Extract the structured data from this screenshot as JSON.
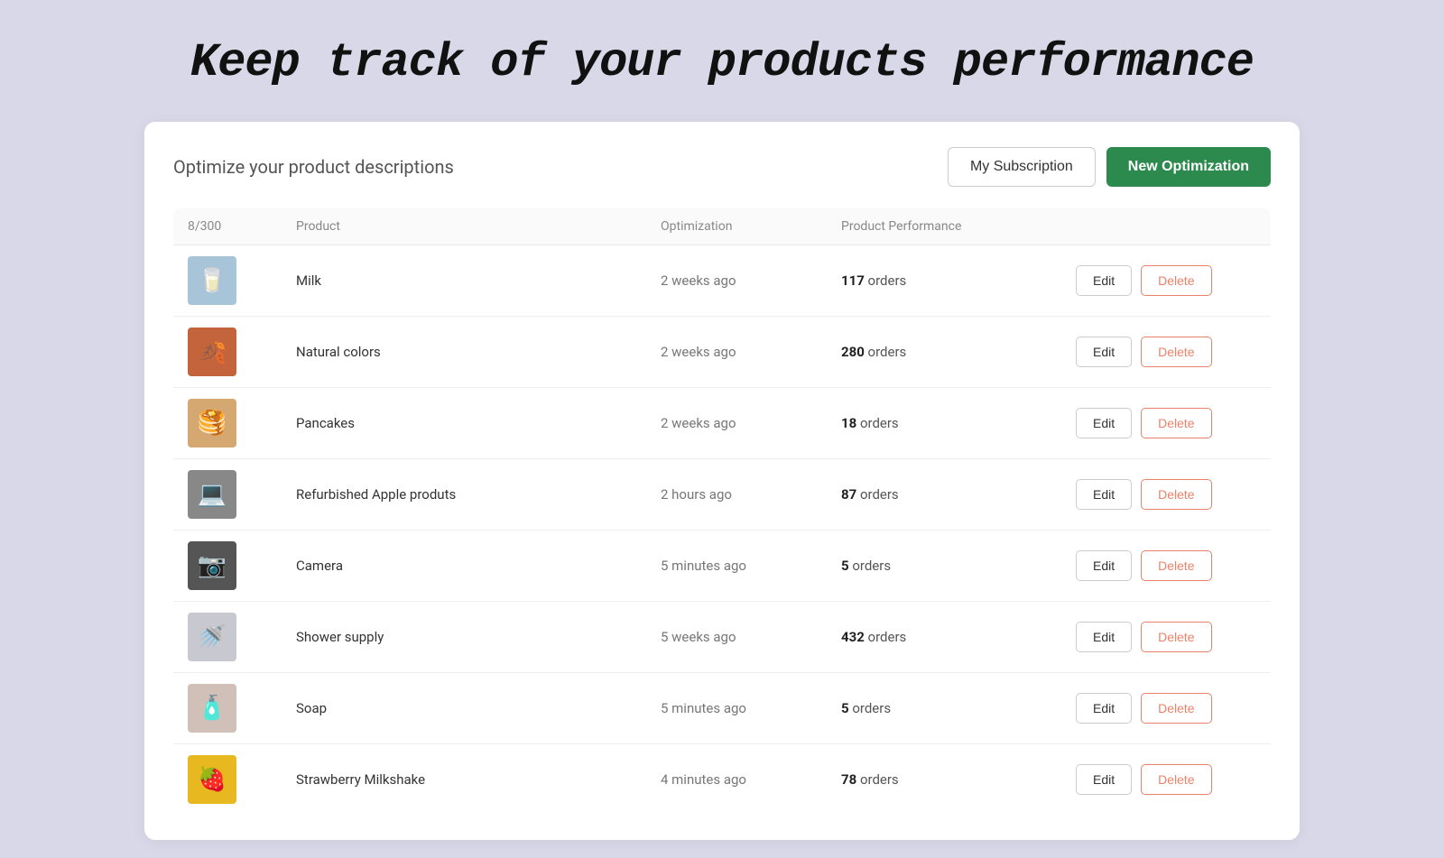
{
  "page": {
    "heading": "Keep track of your products performance",
    "card": {
      "title": "Optimize your product descriptions",
      "buttons": {
        "subscription": "My Subscription",
        "new_optimization": "New Optimization"
      },
      "table": {
        "counter": "8/300",
        "columns": [
          "",
          "Product",
          "Optimization",
          "Product Performance",
          "",
          ""
        ],
        "col_labels": {
          "counter": "8/300",
          "product": "Product",
          "optimization": "Optimization",
          "performance": "Product Performance"
        },
        "rows": [
          {
            "id": 1,
            "product": "Milk",
            "optimization": "2 weeks ago",
            "orders_count": "117",
            "orders_label": "orders",
            "thumb_emoji": "🥛",
            "thumb_class": "thumb-milk"
          },
          {
            "id": 2,
            "product": "Natural colors",
            "optimization": "2 weeks ago",
            "orders_count": "280",
            "orders_label": "orders",
            "thumb_emoji": "🍂",
            "thumb_class": "thumb-natural"
          },
          {
            "id": 3,
            "product": "Pancakes",
            "optimization": "2 weeks ago",
            "orders_count": "18",
            "orders_label": "orders",
            "thumb_emoji": "🥞",
            "thumb_class": "thumb-pancakes"
          },
          {
            "id": 4,
            "product": "Refurbished Apple produts",
            "optimization": "2 hours ago",
            "orders_count": "87",
            "orders_label": "orders",
            "thumb_emoji": "💻",
            "thumb_class": "thumb-apple"
          },
          {
            "id": 5,
            "product": "Camera",
            "optimization": "5 minutes ago",
            "orders_count": "5",
            "orders_label": "orders",
            "thumb_emoji": "📷",
            "thumb_class": "thumb-camera"
          },
          {
            "id": 6,
            "product": "Shower supply",
            "optimization": "5 weeks ago",
            "orders_count": "432",
            "orders_label": "orders",
            "thumb_emoji": "🚿",
            "thumb_class": "thumb-shower"
          },
          {
            "id": 7,
            "product": "Soap",
            "optimization": "5 minutes ago",
            "orders_count": "5",
            "orders_label": "orders",
            "thumb_emoji": "🧴",
            "thumb_class": "thumb-soap"
          },
          {
            "id": 8,
            "product": "Strawberry Milkshake",
            "optimization": "4 minutes ago",
            "orders_count": "78",
            "orders_label": "orders",
            "thumb_emoji": "🍓",
            "thumb_class": "thumb-strawberry"
          }
        ],
        "edit_label": "Edit",
        "delete_label": "Delete"
      }
    }
  }
}
